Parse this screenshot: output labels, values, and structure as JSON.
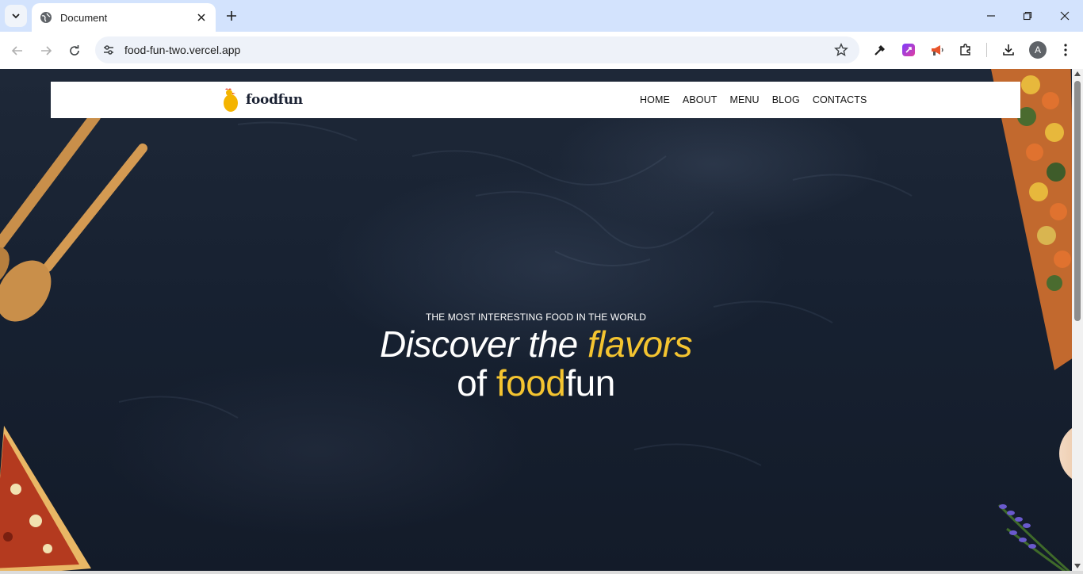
{
  "browser": {
    "tab_title": "Document",
    "url": "food-fun-two.vercel.app",
    "profile_initial": "A"
  },
  "icons": {
    "tab_search": "chevron-down-icon",
    "globe": "globe-icon",
    "close_tab": "close-icon",
    "new_tab": "plus-icon",
    "back": "arrow-left-icon",
    "forward": "arrow-right-icon",
    "reload": "reload-icon",
    "site_info": "tune-icon",
    "bookmark": "star-icon",
    "eyedropper": "eyedropper-icon",
    "ext_purple": "extension-purple-icon",
    "ext_megaphone": "megaphone-icon",
    "extensions": "puzzle-icon",
    "downloads": "download-icon",
    "menu": "kebab-menu-icon"
  },
  "site": {
    "brand": "foodfun",
    "nav": [
      "HOME",
      "ABOUT",
      "MENU",
      "BLOG",
      "CONTACTS"
    ],
    "hero": {
      "kicker": "THE MOST INTERESTING FOOD IN THE WORLD",
      "line1_a": "Discover the ",
      "line1_accent": "flavors",
      "line2_a": "of ",
      "line2_accent": "food",
      "line2_b": "fun"
    }
  },
  "colors": {
    "accent": "#f4c430",
    "hero_bg": "#172131",
    "chrome": "#d3e3fd"
  }
}
